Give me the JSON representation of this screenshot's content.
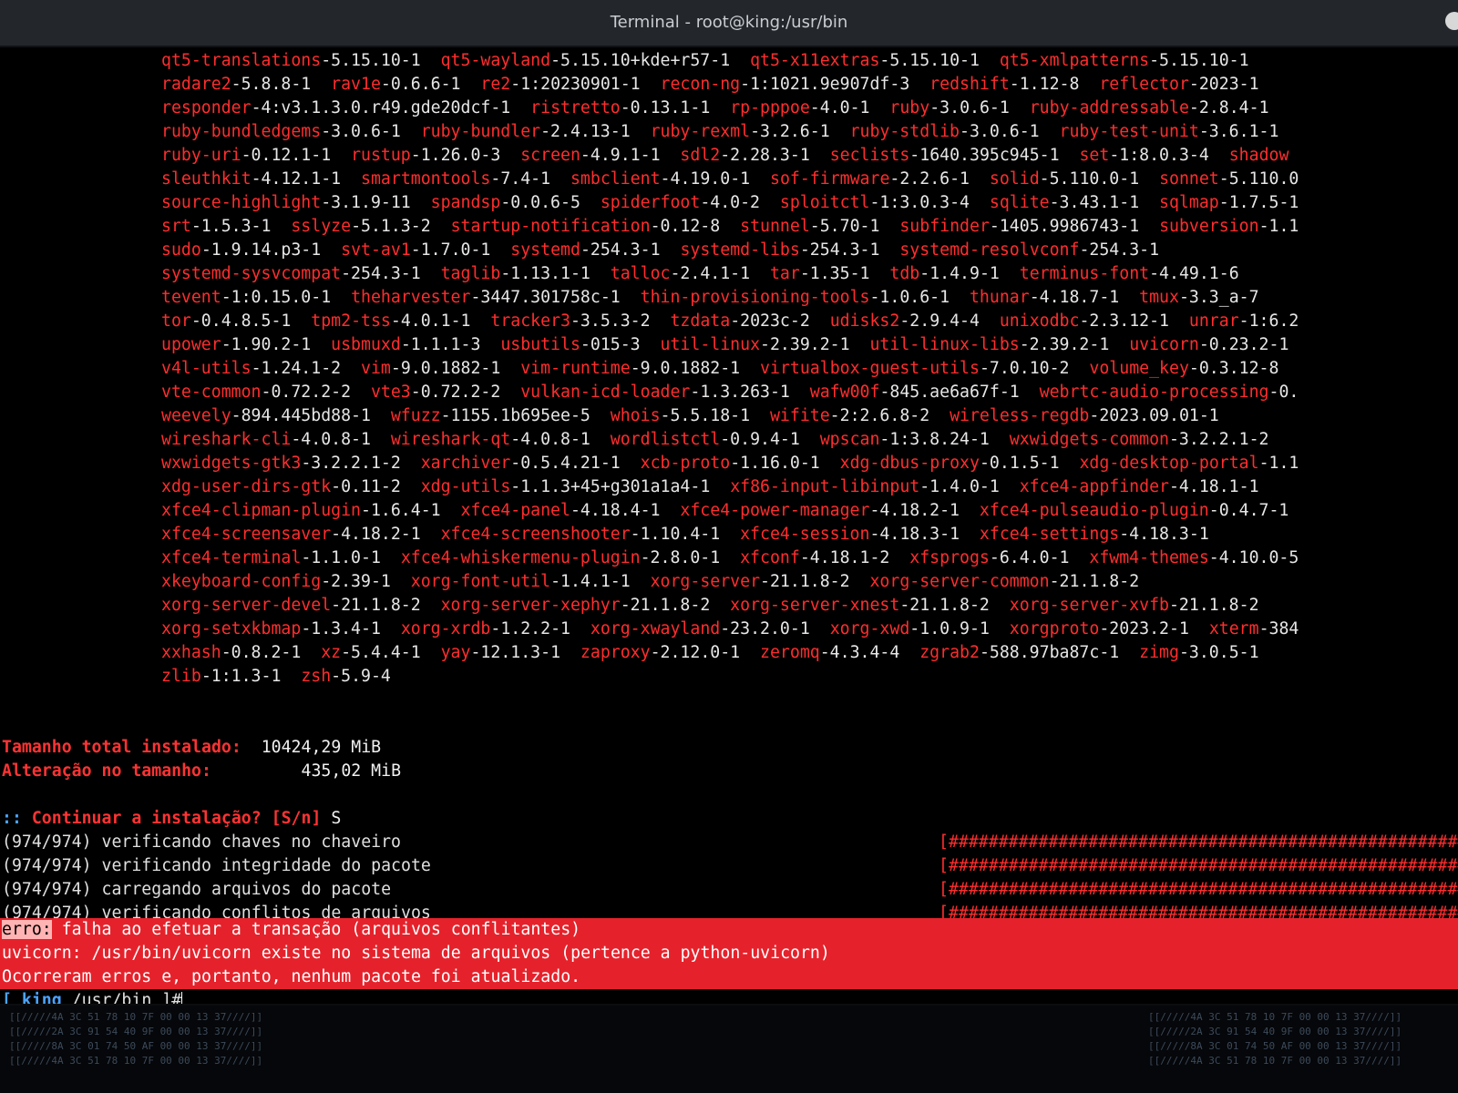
{
  "window": {
    "title": "Terminal - root@king:/usr/bin"
  },
  "packages": [
    [
      "qt5-translations",
      "-5.15.10-1  ",
      "qt5-wayland",
      "-5.15.10+kde+r57-1  ",
      "qt5-x11extras",
      "-5.15.10-1  ",
      "qt5-xmlpatterns",
      "-5.15.10-1"
    ],
    [
      "radare2",
      "-5.8.8-1  ",
      "rav1e",
      "-0.6.6-1  ",
      "re2",
      "-1:20230901-1  ",
      "recon-ng",
      "-1:1021.9e907df-3  ",
      "redshift",
      "-1.12-8  ",
      "reflector",
      "-2023-1"
    ],
    [
      "responder",
      "-4:v3.1.3.0.r49.gde20dcf-1  ",
      "ristretto",
      "-0.13.1-1  ",
      "rp-pppoe",
      "-4.0-1  ",
      "ruby",
      "-3.0.6-1  ",
      "ruby-addressable",
      "-2.8.4-1"
    ],
    [
      "ruby-bundledgems",
      "-3.0.6-1  ",
      "ruby-bundler",
      "-2.4.13-1  ",
      "ruby-rexml",
      "-3.2.6-1  ",
      "ruby-stdlib",
      "-3.0.6-1  ",
      "ruby-test-unit",
      "-3.6.1-1"
    ],
    [
      "ruby-uri",
      "-0.12.1-1  ",
      "rustup",
      "-1.26.0-3  ",
      "screen",
      "-4.9.1-1  ",
      "sdl2",
      "-2.28.3-1  ",
      "seclists",
      "-1640.395c945-1  ",
      "set",
      "-1:8.0.3-4  ",
      "shadow",
      ""
    ],
    [
      "sleuthkit",
      "-4.12.1-1  ",
      "smartmontools",
      "-7.4-1  ",
      "smbclient",
      "-4.19.0-1  ",
      "sof-firmware",
      "-2.2.6-1  ",
      "solid",
      "-5.110.0-1  ",
      "sonnet",
      "-5.110.0"
    ],
    [
      "source-highlight",
      "-3.1.9-11  ",
      "spandsp",
      "-0.0.6-5  ",
      "spiderfoot",
      "-4.0-2  ",
      "sploitctl",
      "-1:3.0.3-4  ",
      "sqlite",
      "-3.43.1-1  ",
      "sqlmap",
      "-1.7.5-1"
    ],
    [
      "srt",
      "-1.5.3-1  ",
      "sslyze",
      "-5.1.3-2  ",
      "startup-notification",
      "-0.12-8  ",
      "stunnel",
      "-5.70-1  ",
      "subfinder",
      "-1405.9986743-1  ",
      "subversion",
      "-1.1"
    ],
    [
      "sudo",
      "-1.9.14.p3-1  ",
      "svt-av1",
      "-1.7.0-1  ",
      "systemd",
      "-254.3-1  ",
      "systemd-libs",
      "-254.3-1  ",
      "systemd-resolvconf",
      "-254.3-1"
    ],
    [
      "systemd-sysvcompat",
      "-254.3-1  ",
      "taglib",
      "-1.13.1-1  ",
      "talloc",
      "-2.4.1-1  ",
      "tar",
      "-1.35-1  ",
      "tdb",
      "-1.4.9-1  ",
      "terminus-font",
      "-4.49.1-6"
    ],
    [
      "tevent",
      "-1:0.15.0-1  ",
      "theharvester",
      "-3447.301758c-1  ",
      "thin-provisioning-tools",
      "-1.0.6-1  ",
      "thunar",
      "-4.18.7-1  ",
      "tmux",
      "-3.3_a-7"
    ],
    [
      "tor",
      "-0.4.8.5-1  ",
      "tpm2-tss",
      "-4.0.1-1  ",
      "tracker3",
      "-3.5.3-2  ",
      "tzdata",
      "-2023c-2  ",
      "udisks2",
      "-2.9.4-4  ",
      "unixodbc",
      "-2.3.12-1  ",
      "unrar",
      "-1:6.2"
    ],
    [
      "upower",
      "-1.90.2-1  ",
      "usbmuxd",
      "-1.1.1-3  ",
      "usbutils",
      "-015-3  ",
      "util-linux",
      "-2.39.2-1  ",
      "util-linux-libs",
      "-2.39.2-1  ",
      "uvicorn",
      "-0.23.2-1"
    ],
    [
      "v4l-utils",
      "-1.24.1-2  ",
      "vim",
      "-9.0.1882-1  ",
      "vim-runtime",
      "-9.0.1882-1  ",
      "virtualbox-guest-utils",
      "-7.0.10-2  ",
      "volume_key",
      "-0.3.12-8"
    ],
    [
      "vte-common",
      "-0.72.2-2  ",
      "vte3",
      "-0.72.2-2  ",
      "vulkan-icd-loader",
      "-1.3.263-1  ",
      "wafw00f",
      "-845.ae6a67f-1  ",
      "webrtc-audio-processing",
      "-0."
    ],
    [
      "weevely",
      "-894.445bd88-1  ",
      "wfuzz",
      "-1155.1b695ee-5  ",
      "whois",
      "-5.5.18-1  ",
      "wifite",
      "-2:2.6.8-2  ",
      "wireless-regdb",
      "-2023.09.01-1"
    ],
    [
      "wireshark-cli",
      "-4.0.8-1  ",
      "wireshark-qt",
      "-4.0.8-1  ",
      "wordlistctl",
      "-0.9.4-1  ",
      "wpscan",
      "-1:3.8.24-1  ",
      "wxwidgets-common",
      "-3.2.2.1-2"
    ],
    [
      "wxwidgets-gtk3",
      "-3.2.2.1-2  ",
      "xarchiver",
      "-0.5.4.21-1  ",
      "xcb-proto",
      "-1.16.0-1  ",
      "xdg-dbus-proxy",
      "-0.1.5-1  ",
      "xdg-desktop-portal",
      "-1.1"
    ],
    [
      "xdg-user-dirs-gtk",
      "-0.11-2  ",
      "xdg-utils",
      "-1.1.3+45+g301a1a4-1  ",
      "xf86-input-libinput",
      "-1.4.0-1  ",
      "xfce4-appfinder",
      "-4.18.1-1"
    ],
    [
      "xfce4-clipman-plugin",
      "-1.6.4-1  ",
      "xfce4-panel",
      "-4.18.4-1  ",
      "xfce4-power-manager",
      "-4.18.2-1  ",
      "xfce4-pulseaudio-plugin",
      "-0.4.7-1"
    ],
    [
      "xfce4-screensaver",
      "-4.18.2-1  ",
      "xfce4-screenshooter",
      "-1.10.4-1  ",
      "xfce4-session",
      "-4.18.3-1  ",
      "xfce4-settings",
      "-4.18.3-1"
    ],
    [
      "xfce4-terminal",
      "-1.1.0-1  ",
      "xfce4-whiskermenu-plugin",
      "-2.8.0-1  ",
      "xfconf",
      "-4.18.1-2  ",
      "xfsprogs",
      "-6.4.0-1  ",
      "xfwm4-themes",
      "-4.10.0-5"
    ],
    [
      "xkeyboard-config",
      "-2.39-1  ",
      "xorg-font-util",
      "-1.4.1-1  ",
      "xorg-server",
      "-21.1.8-2  ",
      "xorg-server-common",
      "-21.1.8-2"
    ],
    [
      "xorg-server-devel",
      "-21.1.8-2  ",
      "xorg-server-xephyr",
      "-21.1.8-2  ",
      "xorg-server-xnest",
      "-21.1.8-2  ",
      "xorg-server-xvfb",
      "-21.1.8-2"
    ],
    [
      "xorg-setxkbmap",
      "-1.3.4-1  ",
      "xorg-xrdb",
      "-1.2.2-1  ",
      "xorg-xwayland",
      "-23.2.0-1  ",
      "xorg-xwd",
      "-1.0.9-1  ",
      "xorgproto",
      "-2023.2-1  ",
      "xterm",
      "-384"
    ],
    [
      "xxhash",
      "-0.8.2-1  ",
      "xz",
      "-5.4.4-1  ",
      "yay",
      "-12.1.3-1  ",
      "zaproxy",
      "-2.12.0-1  ",
      "zeromq",
      "-4.3.4-4  ",
      "zgrab2",
      "-588.97ba87c-1  ",
      "zimg",
      "-3.0.5-1"
    ],
    [
      "zlib",
      "-1:1.3-1  ",
      "zsh",
      "-5.9-4"
    ]
  ],
  "summary": {
    "total_label": "Tamanho total instalado:",
    "total_value": "10424,29 MiB",
    "change_label": "Alteração no tamanho:",
    "change_value": "435,02 MiB"
  },
  "confirm": {
    "prefix": "::",
    "question": "Continuar a instalação? [S/n]",
    "answer": "S"
  },
  "progress": [
    {
      "text": "(974/974) verificando chaves no chaveiro",
      "bar": "[####################################################"
    },
    {
      "text": "(974/974) verificando integridade do pacote",
      "bar": "[####################################################"
    },
    {
      "text": "(974/974) carregando arquivos do pacote",
      "bar": "[####################################################"
    },
    {
      "text": "(974/974) verificando conflitos de arquivos",
      "bar": "[####################################################"
    }
  ],
  "errors": {
    "prefix": "erro:",
    "line1": "falha ao efetuar a transação (arquivos conflitantes)",
    "line2": "uvicorn: /usr/bin/uvicorn existe no sistema de arquivos (pertence a python-uvicorn)",
    "line3": "Ocorreram erros e, portanto, nenhum pacote foi atualizado."
  },
  "prompt": {
    "open": "[",
    "user": "king",
    "path": "/usr/bin",
    "close": "]#"
  },
  "background_text": [
    "[[/////4A 3C 51 78 10 7F 00 00 13 37////]]",
    "[[/////2A 3C 91 54 40 9F 00 00 13 37////]]",
    "[[/////8A 3C 01 74 50 AF 00 00 13 37////]]",
    "[[/////4A 3C 51 78 10 7F 00 00 13 37////]]"
  ],
  "colors": {
    "package_name": "#ff2d2d",
    "error_background": "#e5222b",
    "prompt_accent": "#4aa3ff"
  }
}
